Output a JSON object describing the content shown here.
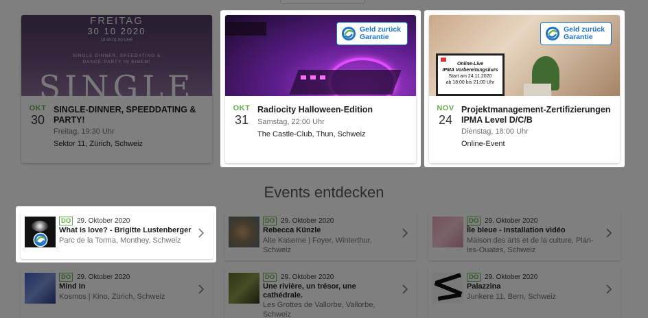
{
  "featured": [
    {
      "month": "OKT",
      "day": "30",
      "title": "SINGLE-DINNER, SPEEDDATING & PARTY!",
      "time": "Freitag, 19:30 Uhr",
      "place": "Sektor 11, Zürich, Schweiz",
      "poster": {
        "weekday": "FREITAG",
        "date": "30 10 2020",
        "hours": "19:30-01:00 UHR",
        "line1": "SINGLE DINNER, SPEEDATING &",
        "line2": "DANCE-PARTY IN EINEM!",
        "big": "SINGLE"
      }
    },
    {
      "month": "OKT",
      "day": "31",
      "title": "Radiocity Halloween-Edition",
      "time": "Samstag, 22:00 Uhr",
      "place": "The Castle-Club, Thun, Schweiz"
    },
    {
      "month": "NOV",
      "day": "24",
      "title": "Projektmanagement-Zertifizierungen IPMA Level D/C/B",
      "time": "Dienstag, 18:00 Uhr",
      "place": "Online-Event",
      "poster": {
        "l1": "Online-Live",
        "l2": "IPMA Vorbereitungskurs",
        "l3": "Start am 24.11.2020",
        "l4": "ab 18:00 bis 21:00 Uhr"
      }
    }
  ],
  "badge": {
    "line1": "Geld zurück",
    "line2": "Garantie"
  },
  "section_title": "Events entdecken",
  "events": [
    {
      "tag": "DO",
      "date": "29. Oktober 2020",
      "title": "What is love? - Brigitte Lustenberger",
      "location": "Parc de la Torma, Monthey, Schweiz"
    },
    {
      "tag": "DO",
      "date": "29. Oktober 2020",
      "title": "Rebecca Künzle",
      "location": "Alte Kaserne | Foyer, Winterthur, Schweiz"
    },
    {
      "tag": "DO",
      "date": "29. Oktober 2020",
      "title": "Île bleue - installation vidéo",
      "location": "Maison des arts et de la culture, Plan-les-Ouates, Schweiz"
    },
    {
      "tag": "DO",
      "date": "29. Oktober 2020",
      "title": "Mind In",
      "location": "Kosmos | Kino, Zürich, Schweiz"
    },
    {
      "tag": "DO",
      "date": "29. Oktober 2020",
      "title": "Une rivière, un trésor, une cathédrale.",
      "location": "Les Grottes de Vallorbe, Vallorbe, Schweiz"
    },
    {
      "tag": "DO",
      "date": "29. Oktober 2020",
      "title": "Palazzina",
      "location": "Junkere 11, Bern, Schweiz"
    }
  ],
  "colors": {
    "accent_green": "#63b04a",
    "badge_blue": "#1c74c9",
    "overlay": "#7f7f7f"
  }
}
